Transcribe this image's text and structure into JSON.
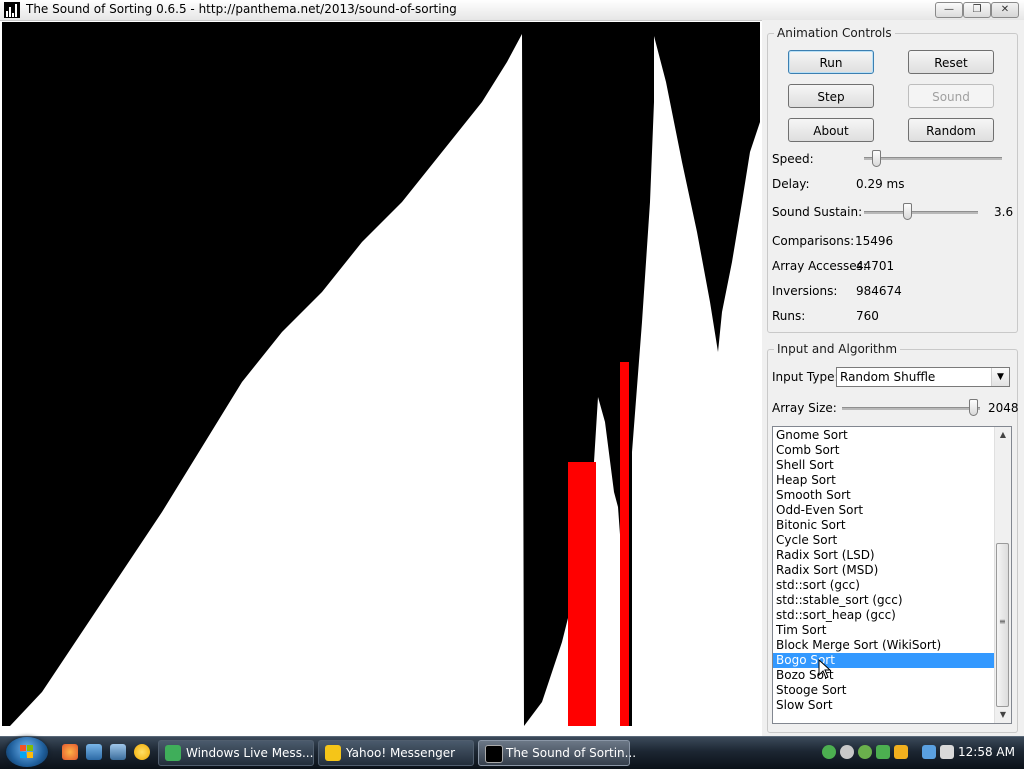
{
  "window": {
    "title": "The Sound of Sorting 0.6.5 - http://panthema.net/2013/sound-of-sorting",
    "controls": {
      "minimize": "minimize",
      "maximize": "maximize",
      "close": "close"
    }
  },
  "animation_controls": {
    "title": "Animation Controls",
    "buttons": {
      "run": "Run",
      "reset": "Reset",
      "step": "Step",
      "sound": "Sound",
      "about": "About",
      "random": "Random"
    },
    "speed_label": "Speed:",
    "speed_level": 0.09,
    "delay_label": "Delay:",
    "delay_value": "0.29 ms",
    "sustain_label": "Sound Sustain:",
    "sustain_value": "3.6",
    "sustain_level": 0.38,
    "stats": [
      {
        "label": "Comparisons:",
        "value": "15496"
      },
      {
        "label": "Array Accesses:",
        "value": "44701"
      },
      {
        "label": "Inversions:",
        "value": "984674"
      },
      {
        "label": "Runs:",
        "value": "760"
      }
    ]
  },
  "input_algorithm": {
    "title": "Input and Algorithm",
    "input_type_label": "Input Type:",
    "input_type_value": "Random Shuffle",
    "array_size_label": "Array Size:",
    "array_size_value": "2048",
    "array_size_level": 0.95,
    "algorithms": [
      "Gnome Sort",
      "Comb Sort",
      "Shell Sort",
      "Heap Sort",
      "Smooth Sort",
      "Odd-Even Sort",
      "Bitonic Sort",
      "Cycle Sort",
      "Radix Sort (LSD)",
      "Radix Sort (MSD)",
      "std::sort (gcc)",
      "std::stable_sort (gcc)",
      "std::sort_heap (gcc)",
      "Tim Sort",
      "Block Merge Sort (WikiSort)",
      "Bogo Sort",
      "Bozo Sort",
      "Stooge Sort",
      "Slow Sort"
    ],
    "selected_algorithm": "Bogo Sort"
  },
  "taskbar": {
    "tasks": [
      {
        "label": "Windows Live Mess...",
        "icon": "messenger-icon",
        "color": "#3fae5a"
      },
      {
        "label": "Yahoo! Messenger",
        "icon": "yahoo-icon",
        "color": "#f5c518"
      },
      {
        "label": "The Sound of Sortin...",
        "icon": "sorting-app-icon",
        "color": "#000000"
      }
    ],
    "clock": "12:58 AM"
  },
  "colors": {
    "bar": "#ffffff",
    "highlight": "#ff0000",
    "background": "#000000",
    "selection": "#3399ff"
  }
}
